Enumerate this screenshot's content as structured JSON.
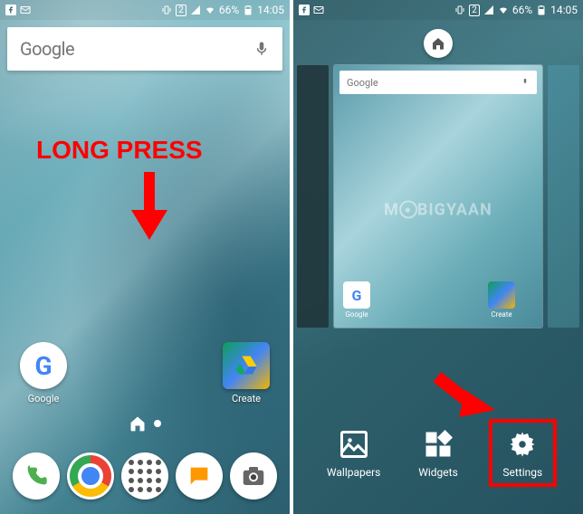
{
  "status": {
    "battery_text": "66%",
    "time": "14:05",
    "sim": "2"
  },
  "left_phone": {
    "search_label": "Google",
    "annotation": "LONG PRESS",
    "home_apps": [
      {
        "label": "Google",
        "icon": "google-g"
      },
      {
        "label": "Create",
        "icon": "drive"
      }
    ]
  },
  "right_phone": {
    "preview_search": "Google",
    "watermark": "BIGYAAN",
    "preview_apps": [
      {
        "label": "Google"
      },
      {
        "label": "Create"
      }
    ],
    "options": [
      {
        "label": "Wallpapers",
        "name": "wallpapers-option"
      },
      {
        "label": "Widgets",
        "name": "widgets-option"
      },
      {
        "label": "Settings",
        "name": "settings-option",
        "highlighted": true
      }
    ]
  }
}
